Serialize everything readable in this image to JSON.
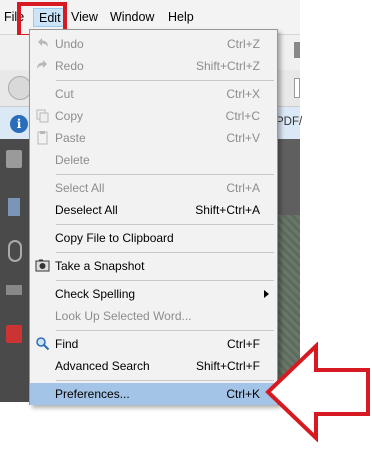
{
  "menubar": {
    "file": "File",
    "edit": "Edit",
    "view": "View",
    "window": "Window",
    "help": "Help"
  },
  "infobar": {
    "partial_text": "PDF/"
  },
  "menu": {
    "items": [
      {
        "label": "Undo",
        "shortcut": "Ctrl+Z",
        "disabled": true,
        "icon": "undo-icon"
      },
      {
        "label": "Redo",
        "shortcut": "Shift+Ctrl+Z",
        "disabled": true,
        "icon": "redo-icon"
      },
      {
        "label": "Cut",
        "shortcut": "Ctrl+X",
        "disabled": true,
        "icon": ""
      },
      {
        "label": "Copy",
        "shortcut": "Ctrl+C",
        "disabled": true,
        "icon": "copy-icon"
      },
      {
        "label": "Paste",
        "shortcut": "Ctrl+V",
        "disabled": true,
        "icon": "paste-icon"
      },
      {
        "label": "Delete",
        "shortcut": "",
        "disabled": true,
        "icon": ""
      },
      {
        "label": "Select All",
        "shortcut": "Ctrl+A",
        "disabled": true,
        "icon": ""
      },
      {
        "label": "Deselect All",
        "shortcut": "Shift+Ctrl+A",
        "disabled": false,
        "icon": ""
      },
      {
        "label": "Copy File to Clipboard",
        "shortcut": "",
        "disabled": false,
        "icon": ""
      },
      {
        "label": "Take a Snapshot",
        "shortcut": "",
        "disabled": false,
        "icon": "camera-icon"
      },
      {
        "label": "Check Spelling",
        "shortcut": "",
        "disabled": false,
        "icon": "",
        "submenu": true
      },
      {
        "label": "Look Up Selected Word...",
        "shortcut": "",
        "disabled": true,
        "icon": ""
      },
      {
        "label": "Find",
        "shortcut": "Ctrl+F",
        "disabled": false,
        "icon": "magnifier-icon"
      },
      {
        "label": "Advanced Search",
        "shortcut": "Shift+Ctrl+F",
        "disabled": false,
        "icon": ""
      },
      {
        "label": "Preferences...",
        "shortcut": "Ctrl+K",
        "disabled": false,
        "icon": "",
        "selected": true
      }
    ]
  },
  "colors": {
    "highlight_red": "#d71921",
    "menu_bg": "#f2f2f2",
    "selected_bg": "#a3c4e6"
  }
}
